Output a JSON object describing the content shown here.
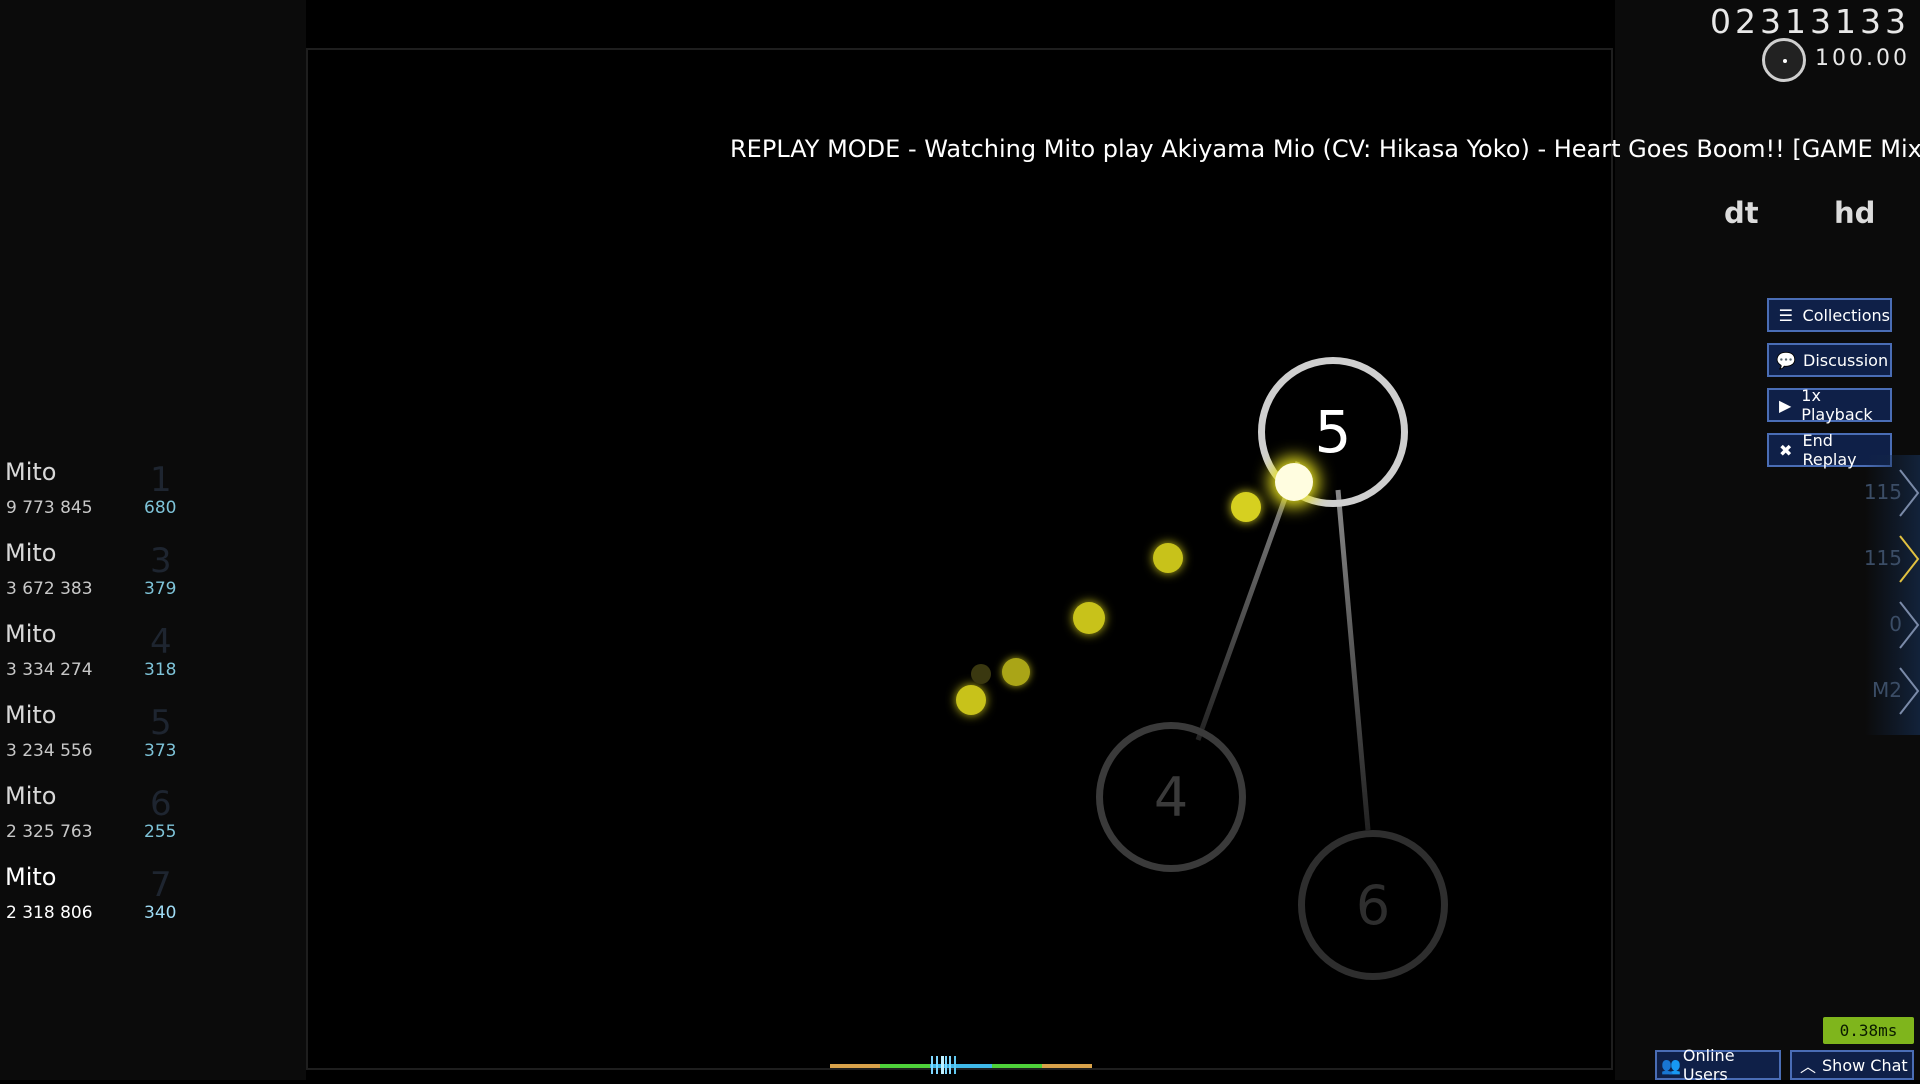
{
  "hud": {
    "score": "02313133",
    "accuracy": "100.00",
    "mods": [
      "dt",
      "hd"
    ]
  },
  "replay": {
    "banner": "REPLAY MODE - Watching Mito play Akiyama Mio (CV: Hikasa Yoko) - Heart Goes Boom!! [GAME Mix] [Kenc"
  },
  "side_buttons": {
    "collections": "Collections",
    "discussion": "Discussion",
    "playback": "1x Playback",
    "end_replay": "End Replay"
  },
  "key_overlay": [
    "115",
    "115",
    "0",
    "M2"
  ],
  "leaderboard": [
    {
      "name": "Mito",
      "rank": "1",
      "score": "9 773 845",
      "combo": "680"
    },
    {
      "name": "Mito",
      "rank": "3",
      "score": "3 672 383",
      "combo": "379"
    },
    {
      "name": "Mito",
      "rank": "4",
      "score": "3 334 274",
      "combo": "318"
    },
    {
      "name": "Mito",
      "rank": "5",
      "score": "3 234 556",
      "combo": "373"
    },
    {
      "name": "Mito",
      "rank": "6",
      "score": "2 325 763",
      "combo": "255"
    },
    {
      "name": "Mito",
      "rank": "7",
      "score": "2 318 806",
      "combo": "340"
    }
  ],
  "hit_objects": {
    "circle_5": "5",
    "circle_4": "4",
    "circle_6": "6"
  },
  "status": {
    "latency": "0.38ms"
  },
  "bottom_buttons": {
    "online_users": "Online Users",
    "show_chat": "Show Chat"
  },
  "colors": {
    "button_bg": "#0f2048",
    "button_border": "#4a6db5",
    "cursor_trail": "#e6e020",
    "latency_bg": "#7fb51c"
  }
}
